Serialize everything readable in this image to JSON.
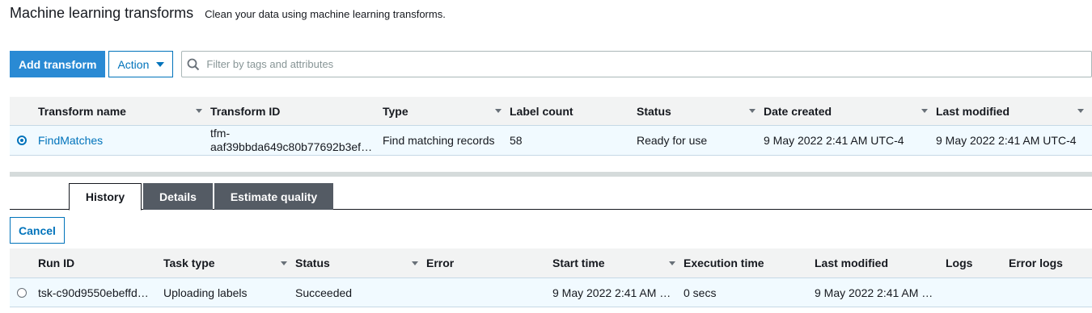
{
  "header": {
    "title": "Machine learning transforms",
    "description": "Clean your data using machine learning transforms."
  },
  "toolbar": {
    "add_label": "Add transform",
    "action_label": "Action",
    "filter_placeholder": "Filter by tags and attributes"
  },
  "transforms": {
    "columns": [
      "Transform name",
      "Transform ID",
      "Type",
      "Label count",
      "Status",
      "Date created",
      "Last modified"
    ],
    "rows": [
      {
        "selected": true,
        "name": "FindMatches",
        "id_line1": "tfm-",
        "id_line2": "aaf39bbda649c80b77692b3ef…",
        "type": "Find matching records",
        "label_count": "58",
        "status": "Ready for use",
        "date_created": "9 May 2022 2:41 AM UTC-4",
        "last_modified": "9 May 2022 2:41 AM UTC-4"
      }
    ]
  },
  "tabs": [
    "History",
    "Details",
    "Estimate quality"
  ],
  "history": {
    "cancel_label": "Cancel",
    "columns": [
      "Run ID",
      "Task type",
      "Status",
      "Error",
      "Start time",
      "Execution time",
      "Last modified",
      "Logs",
      "Error logs"
    ],
    "rows": [
      {
        "selected": false,
        "run_id": "tsk-c90d9550ebeffd…",
        "task_type": "Uploading labels",
        "status": "Succeeded",
        "error": "",
        "start_time": "9 May 2022 2:41 AM …",
        "execution_time": "0 secs",
        "last_modified": "9 May 2022 2:41 AM …",
        "logs": "",
        "error_logs": ""
      }
    ]
  },
  "colors": {
    "primary": "#2a8ad4",
    "link": "#0073bb",
    "selected_row": "#f1faff",
    "header_bg": "#f2f3f3",
    "tab_inactive": "#545b64"
  }
}
